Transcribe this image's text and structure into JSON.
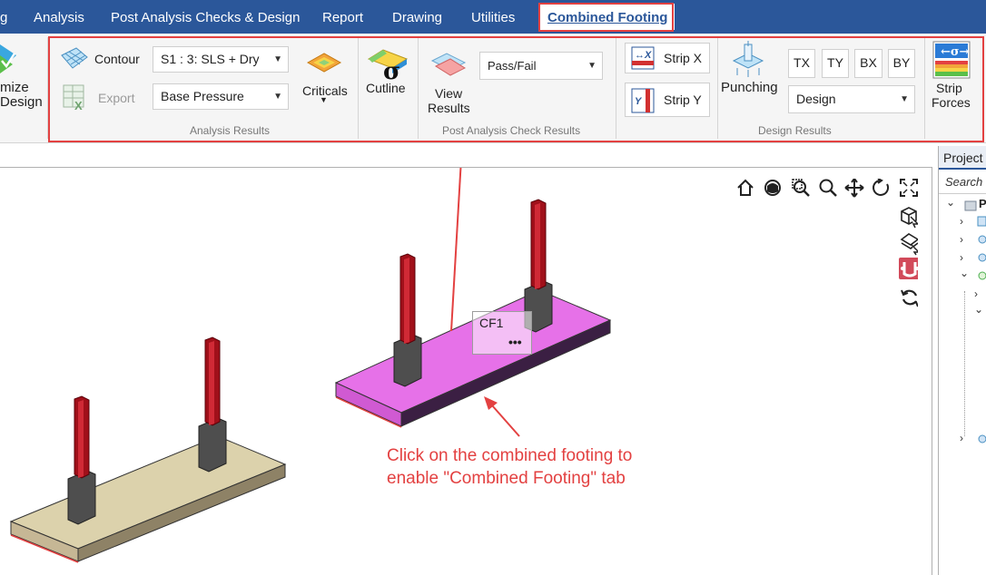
{
  "menu": {
    "tabs": [
      {
        "label": "g"
      },
      {
        "label": "Analysis"
      },
      {
        "label": "Post Analysis Checks & Design"
      },
      {
        "label": "Report"
      },
      {
        "label": "Drawing"
      },
      {
        "label": "Utilities"
      },
      {
        "label": "Combined Footing"
      }
    ]
  },
  "ribbon": {
    "optimize": {
      "line1": "mize",
      "line2": "Design"
    },
    "contour_label": "Contour",
    "export_label": "Export",
    "load_combo": {
      "value": "S1 : 3: SLS + Dry"
    },
    "result_type": {
      "value": "Base Pressure"
    },
    "criticals_label": "Criticals",
    "cutline_label": "Cutline",
    "analysis_group": "Analysis Results",
    "view_results": {
      "line1": "View",
      "line2": "Results"
    },
    "pass_fail": {
      "value": "Pass/Fail"
    },
    "post_group": "Post Analysis Check Results",
    "strip_x": "Strip X",
    "strip_y": "Strip Y",
    "punching": "Punching",
    "tx": "TX",
    "ty": "TY",
    "bx": "BX",
    "by": "BY",
    "design_combo": {
      "value": "Design"
    },
    "design_group": "Design Results",
    "strip_forces": {
      "line1": "Strip",
      "line2": "Forces"
    },
    "icon_sigma": "σ"
  },
  "viewport": {
    "cf_label": "CF1",
    "cf_more": "•••",
    "annotation": {
      "line1": "Click on the combined footing to",
      "line2": "enable \"Combined Footing\" tab"
    },
    "colors": {
      "selected": "#e671e8",
      "unselected": "#dcd2ac",
      "column": "#a0101a",
      "annotation": "#e34141"
    }
  },
  "side_panel": {
    "title": "Project",
    "search_placeholder": "Search",
    "root_initial": "P"
  }
}
